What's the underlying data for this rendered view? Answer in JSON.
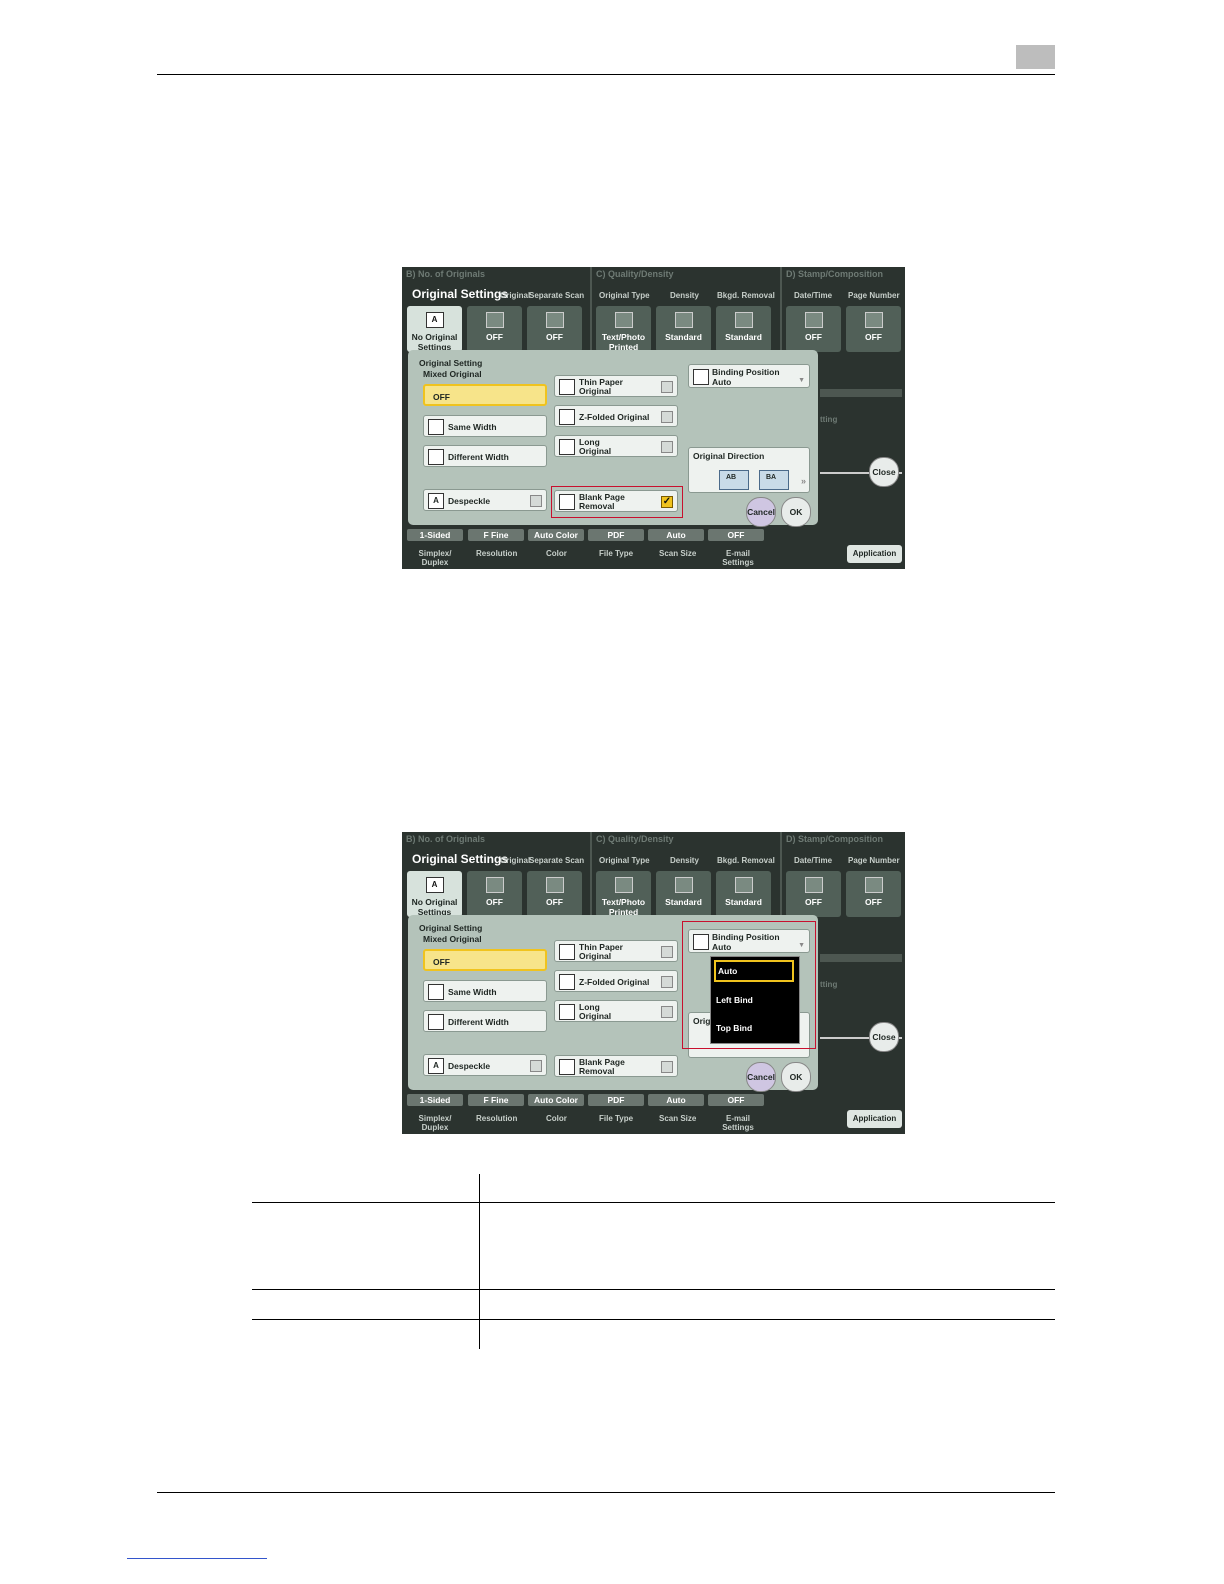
{
  "screen": {
    "sections": {
      "b": "B)   No. of Originals",
      "c": "C)   Quality/Density",
      "d": "D)   Stamp/Composition"
    },
    "title": "Original Settings",
    "column_labels": [
      "Original",
      "Separate Scan",
      "Original Type",
      "Density",
      "Bkgd. Removal",
      "Date/Time",
      "Page Number"
    ],
    "top_buttons": [
      {
        "label": "No Original Settings",
        "icon": "A"
      },
      {
        "label": "OFF"
      },
      {
        "label": "OFF"
      },
      {
        "label": "Text/Photo Printed"
      },
      {
        "label": "Standard"
      },
      {
        "label": "Standard"
      },
      {
        "label": "OFF"
      },
      {
        "label": "OFF"
      }
    ],
    "bottom_values": [
      "1-Sided",
      "F Fine",
      "Auto Color",
      "PDF",
      "Auto",
      "OFF"
    ],
    "bottom_labels": [
      "Simplex/ Duplex",
      "Resolution",
      "Color",
      "File Type",
      "Scan Size",
      "E-mail Settings"
    ],
    "application_label": "Application",
    "background_text": "tting",
    "close_label": "Close",
    "dialog": {
      "title": "Original Setting",
      "group_label": "Mixed Original",
      "off_label": "OFF",
      "same_width": "Same Width",
      "different_width": "Different Width",
      "despeckle": "Despeckle",
      "thin_paper_1": "Thin Paper",
      "thin_paper_2": "Original",
      "z_folded": "Z-Folded Original",
      "long_1": "Long",
      "long_2": "Original",
      "blank_page_1": "Blank Page",
      "blank_page_2": "Removal",
      "binding_position": "Binding Position",
      "binding_value": "Auto",
      "original_direction": "Original Direction",
      "orig_partial": "Orig",
      "cancel": "Cancel",
      "ok": "OK"
    },
    "dropdown_options": [
      "Auto",
      "Left Bind",
      "Top Bind"
    ]
  },
  "icons": {
    "glyph_a": "A",
    "dir_glyph_1": "AB",
    "dir_glyph_2": "BA",
    "check": "✓"
  }
}
